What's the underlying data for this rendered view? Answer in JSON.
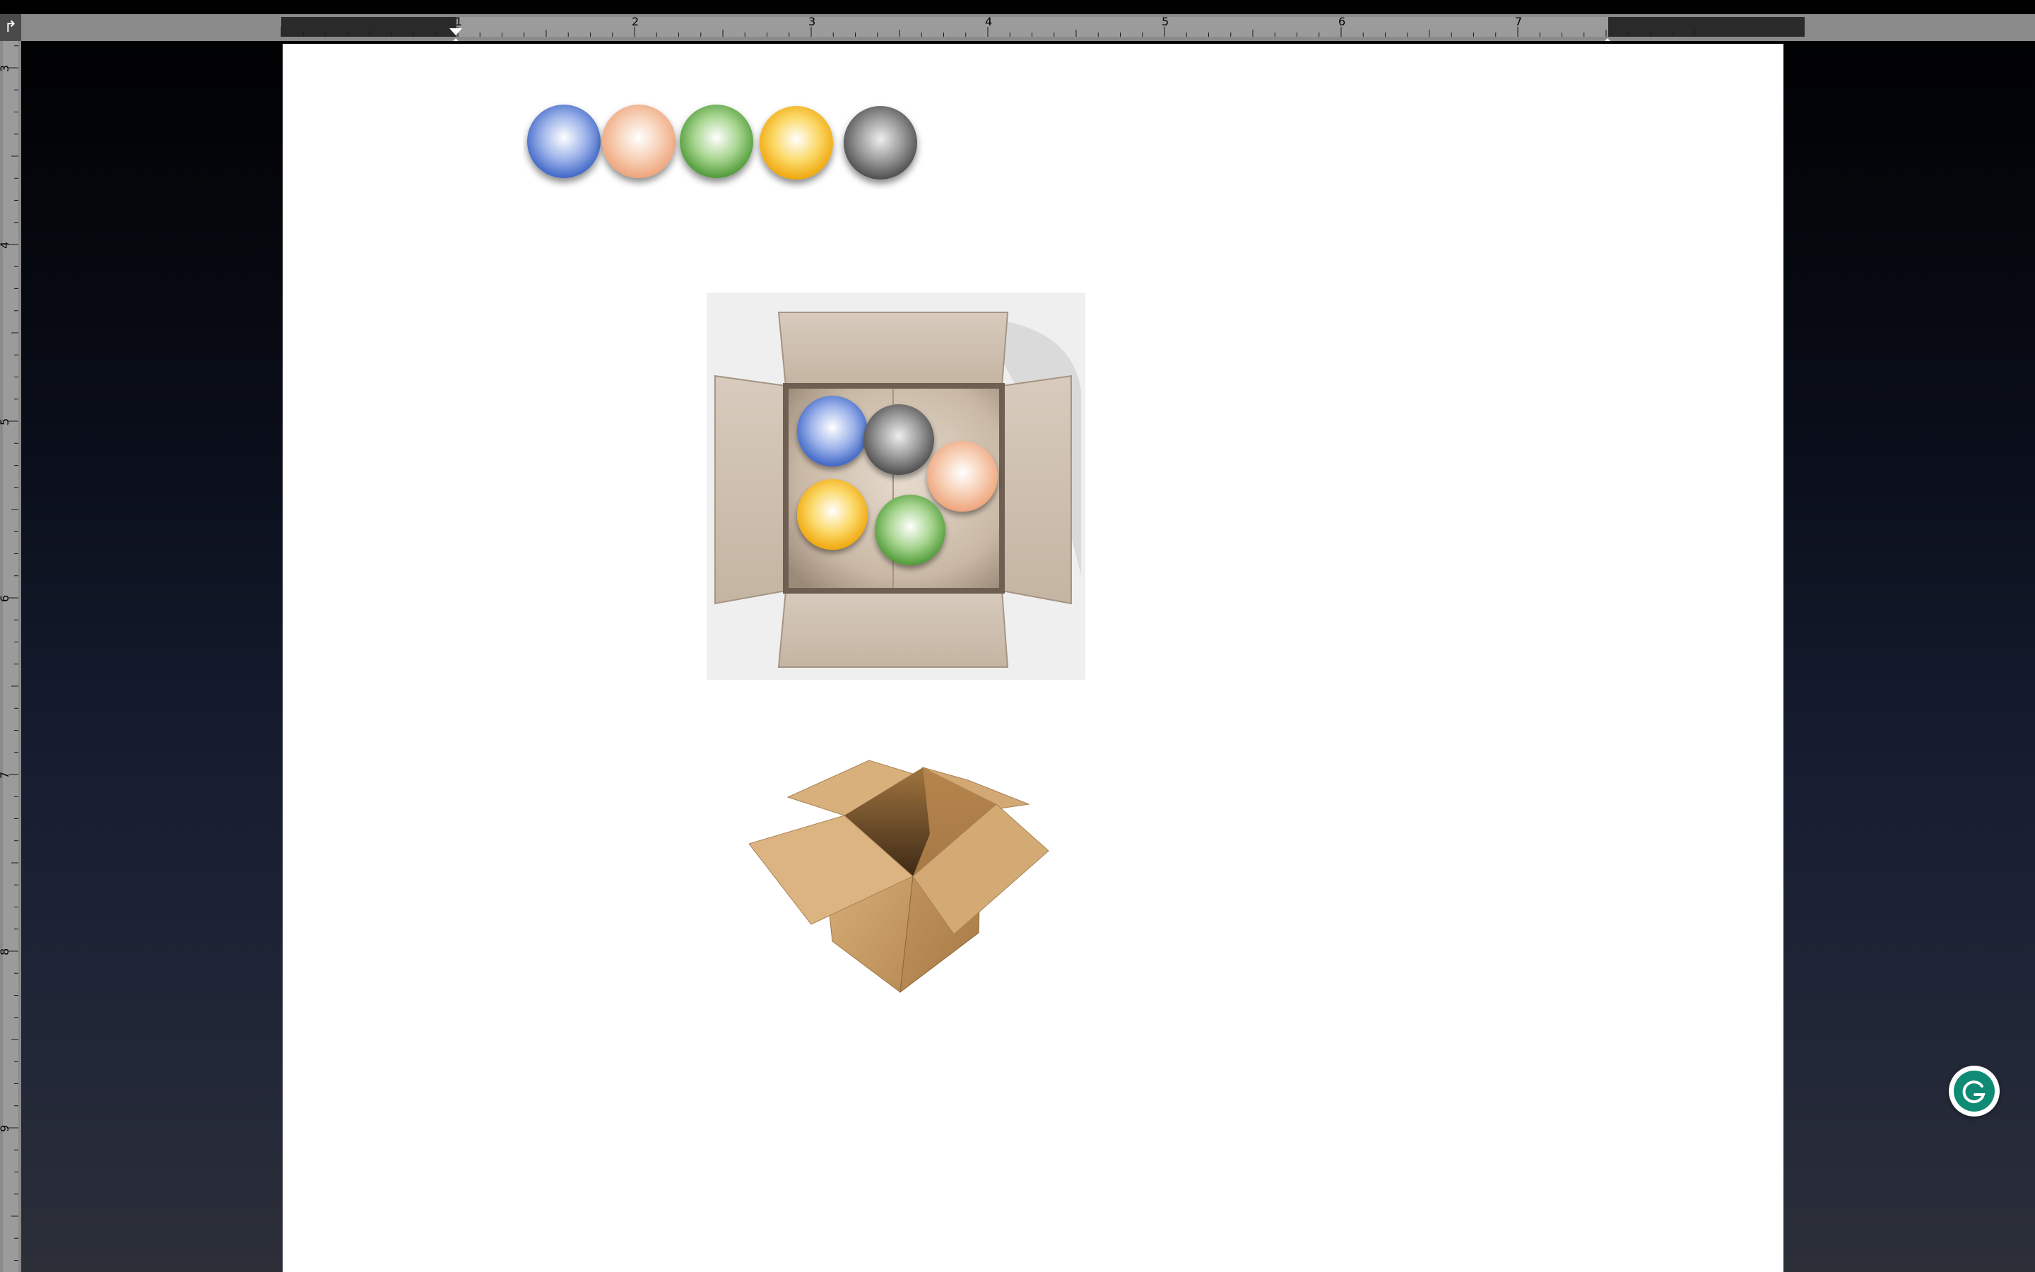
{
  "window": {
    "title_bar": ""
  },
  "rulers": {
    "horizontal_labels": [
      "1",
      "2",
      "3",
      "4",
      "5",
      "6",
      "7"
    ],
    "vertical_labels": [
      "3",
      "4",
      "5",
      "6",
      "7",
      "8",
      "9"
    ],
    "corner_icon": "tab-stop-icon"
  },
  "document": {
    "images": [
      {
        "name": "colored-balls-row",
        "description_icon": "balls-icon"
      },
      {
        "name": "box-with-balls-top-view",
        "description_icon": "box-icon"
      },
      {
        "name": "open-cardboard-box",
        "description_icon": "box-icon"
      }
    ]
  },
  "floating_button": {
    "icon": "grammarly-icon"
  },
  "colors": {
    "ball_blue": "#5b7fd6",
    "ball_peach": "#f3b792",
    "ball_green": "#6db354",
    "ball_yellow": "#f7c22a",
    "ball_gray": "#7a7a7a",
    "cardboard": "#c8a06a",
    "grammarly": "#0f8a74"
  }
}
